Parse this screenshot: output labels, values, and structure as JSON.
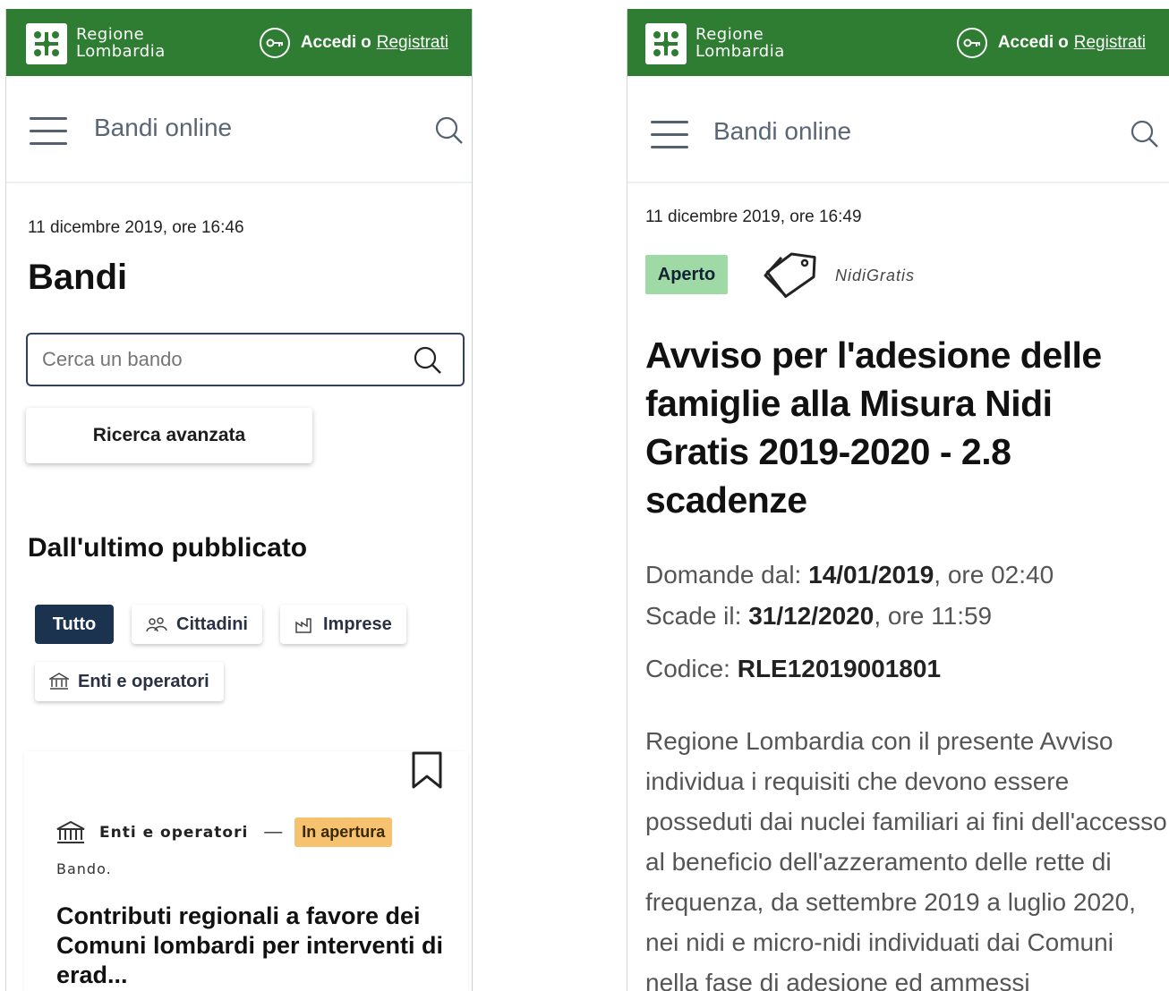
{
  "brand": {
    "line1": "Regione",
    "line2": "Lombardia",
    "green": "#2e7d32"
  },
  "login": {
    "label": "Accedi",
    "or": "o",
    "register": "Registrati"
  },
  "nav": {
    "title": "Bandi online"
  },
  "left": {
    "date": "11 dicembre 2019, ore 16:46",
    "heading": "Bandi",
    "search_placeholder": "Cerca un bando",
    "advanced_search": "Ricerca avanzata",
    "section_title": "Dall'ultimo pubblicato",
    "filters": [
      "Tutto",
      "Cittadini",
      "Imprese",
      "Enti e operatori"
    ],
    "card": {
      "category": "Enti e operatori",
      "dash": "—",
      "status": "In apertura",
      "type": "Bando.",
      "title": "Contributi regionali a favore dei Comuni lombardi per interventi di erad..."
    }
  },
  "right": {
    "date": "11 dicembre 2019, ore 16:49",
    "status": "Aperto",
    "tag": "NidiGratis",
    "title": "Avviso per l'adesione delle famiglie alla Misura Nidi Gratis 2019-2020 - 2.8 scadenze",
    "apply_from_label": "Domande dal:",
    "apply_from_date": "14/01/2019",
    "apply_from_time": ", ore 02:40",
    "expires_label": "Scade il:",
    "expires_date": "31/12/2020",
    "expires_time": ", ore 11:59",
    "code_label": "Codice:",
    "code_value": "RLE12019001801",
    "description": "Regione Lombardia con il presente Avviso individua i requisiti che devono essere posseduti dai nuclei familiari ai fini dell'accesso al beneficio dell'azzeramento delle rette di frequenza, da settembre 2019 a luglio 2020, nei nidi e micro-nidi individuati dai Comuni nella fase di adesione ed ammessi"
  }
}
